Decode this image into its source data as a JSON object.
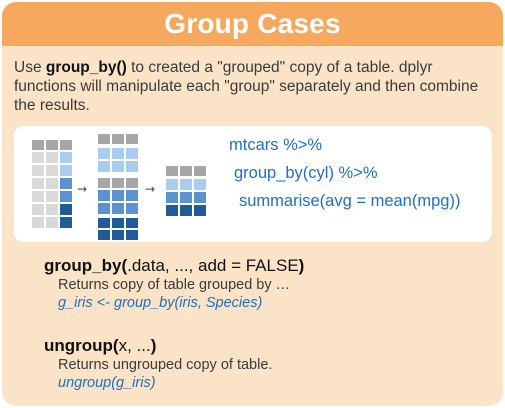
{
  "card": {
    "title": "Group Cases",
    "intro_prefix": "Use ",
    "intro_fn": "group_by()",
    "intro_rest": " to created a \"grouped\" copy of a table. dplyr functions will manipulate each \"group\" separately and then combine the results."
  },
  "example": {
    "code_lines": [
      "mtcars %>%",
      "group_by(cyl) %>%",
      "summarise(avg = mean(mpg))"
    ],
    "arrow_glyph": "→"
  },
  "functions": [
    {
      "name": "group_by",
      "open_paren": "(",
      "args": ".data, ..., add = FALSE",
      "close_paren": ")",
      "description": "Returns copy of table grouped by …",
      "example": "g_iris <- group_by(iris, Species)"
    },
    {
      "name": "ungroup",
      "open_paren": "(",
      "args": "x, ...",
      "close_paren": ")",
      "description": "Returns ungrouped copy of table.",
      "example": "ungroup(g_iris)"
    }
  ],
  "colors": {
    "header_bg": "#f5a85e",
    "card_bg": "#fbe3c7",
    "code_blue": "#1f6fc5",
    "grid_gray_dark": "#a6a6a6",
    "grid_gray_light": "#d9d9d9",
    "grid_blue_light": "#a9cdf0",
    "grid_blue_mid": "#5a93cf",
    "grid_blue_dark": "#1f5a99"
  }
}
